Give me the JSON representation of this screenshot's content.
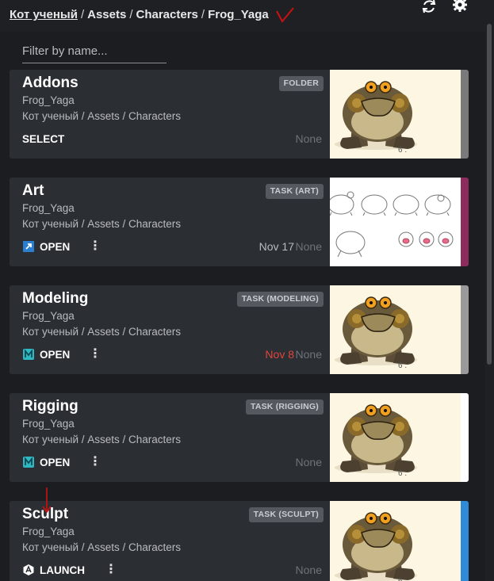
{
  "breadcrumb": {
    "items": [
      "Кот ученый",
      "Assets",
      "Characters",
      "Frog_Yaga"
    ],
    "separator": "/"
  },
  "header_icons": {
    "sync": "sync-icon",
    "settings": "gear-icon"
  },
  "filter": {
    "placeholder": "Filter by name...",
    "value": ""
  },
  "cards": [
    {
      "title": "Addons",
      "badge": "FOLDER",
      "subtitle": "Frog_Yaga",
      "path": "Кот ученый / Assets / Characters",
      "action": "SELECT",
      "action_icon": "",
      "has_menu": false,
      "date": "",
      "date_overdue": false,
      "assignee": "None",
      "thumbnail": "frog-thumbnail",
      "stripe_color": "#7a7a7a"
    },
    {
      "title": "Art",
      "badge": "TASK (ART)",
      "subtitle": "Frog_Yaga",
      "path": "Кот ученый / Assets / Characters",
      "action": "OPEN",
      "action_icon": "open-external-icon",
      "has_menu": true,
      "date": "Nov 17",
      "date_overdue": false,
      "assignee": "None",
      "thumbnail": "frog-sketch-sheet-thumbnail",
      "stripe_color": "#8c2b5c"
    },
    {
      "title": "Modeling",
      "badge": "TASK (MODELING)",
      "subtitle": "Frog_Yaga",
      "path": "Кот ученый / Assets / Characters",
      "action": "OPEN",
      "action_icon": "maya-icon",
      "has_menu": true,
      "date": "Nov 8",
      "date_overdue": true,
      "assignee": "None",
      "thumbnail": "frog-thumbnail",
      "stripe_color": "#9a9a9a"
    },
    {
      "title": "Rigging",
      "badge": "TASK (RIGGING)",
      "subtitle": "Frog_Yaga",
      "path": "Кот ученый / Assets / Characters",
      "action": "OPEN",
      "action_icon": "maya-icon",
      "has_menu": true,
      "date": "",
      "date_overdue": false,
      "assignee": "None",
      "thumbnail": "frog-thumbnail",
      "stripe_color": "#ffffff"
    },
    {
      "title": "Sculpt",
      "badge": "TASK (SCULPT)",
      "subtitle": "Frog_Yaga",
      "path": "Кот ученый / Assets / Characters",
      "action": "LAUNCH",
      "action_icon": "sculpt-app-icon",
      "has_menu": true,
      "date": "",
      "date_overdue": false,
      "assignee": "None",
      "thumbnail": "frog-thumbnail",
      "stripe_color": "#2f8ad8"
    }
  ],
  "colors": {
    "background": "#1b1d21",
    "card": "#2b2e33",
    "badge": "#55595f",
    "overdue": "#e0463c",
    "annotation": "#cc1111"
  }
}
